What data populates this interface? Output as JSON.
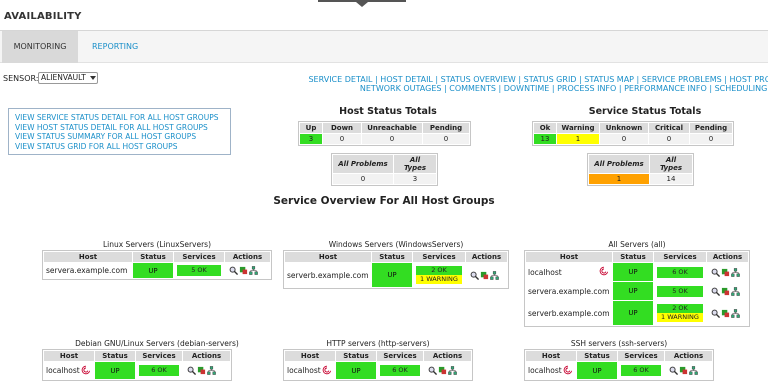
{
  "header": {
    "title": "AVAILABILITY"
  },
  "tabs": {
    "monitoring": "MONITORING",
    "reporting": "REPORTING"
  },
  "sensor": {
    "label": "SENSOR:",
    "value": "ALIENVAULT"
  },
  "nav": {
    "line1": [
      "SERVICE DETAIL",
      "HOST DETAIL",
      "STATUS OVERVIEW",
      "STATUS GRID",
      "STATUS MAP",
      "SERVICE PROBLEMS",
      "HOST PROBLEMS"
    ],
    "line2": [
      "NETWORK OUTAGES",
      "COMMENTS",
      "DOWNTIME",
      "PROCESS INFO",
      "PERFORMANCE INFO",
      "SCHEDULING QUEUE"
    ]
  },
  "links": [
    "VIEW SERVICE STATUS DETAIL FOR ALL HOST GROUPS",
    "VIEW HOST STATUS DETAIL FOR ALL HOST GROUPS",
    "VIEW STATUS SUMMARY FOR ALL HOST GROUPS",
    "VIEW STATUS GRID FOR ALL HOST GROUPS"
  ],
  "host_totals": {
    "title": "Host Status Totals",
    "headers": [
      "Up",
      "Down",
      "Unreachable",
      "Pending"
    ],
    "values": [
      "3",
      "0",
      "0",
      "0"
    ],
    "problem_headers": [
      "All Problems",
      "All Types"
    ],
    "problem_values": [
      "0",
      "3"
    ]
  },
  "service_totals": {
    "title": "Service Status Totals",
    "headers": [
      "Ok",
      "Warning",
      "Unknown",
      "Critical",
      "Pending"
    ],
    "values": [
      "13",
      "1",
      "0",
      "0",
      "0"
    ],
    "problem_headers": [
      "All Problems",
      "All Types"
    ],
    "problem_values": [
      "1",
      "14"
    ]
  },
  "overview_title": "Service Overview For All Host Groups",
  "columns": {
    "host": "Host",
    "status": "Status",
    "services": "Services",
    "actions": "Actions"
  },
  "groups": [
    {
      "title": "Linux Servers (LinuxServers)",
      "rows": [
        {
          "host": "servera.example.com",
          "status": "UP",
          "ok": "5 OK",
          "warn": ""
        }
      ]
    },
    {
      "title": "Windows Servers (WindowsServers)",
      "rows": [
        {
          "host": "serverb.example.com",
          "status": "UP",
          "ok": "2 OK",
          "warn": "1 WARNING"
        }
      ]
    },
    {
      "title": "All Servers (all)",
      "rows": [
        {
          "host": "localhost",
          "status": "UP",
          "ok": "6 OK",
          "warn": ""
        },
        {
          "host": "servera.example.com",
          "status": "UP",
          "ok": "5 OK",
          "warn": ""
        },
        {
          "host": "serverb.example.com",
          "status": "UP",
          "ok": "2 OK",
          "warn": "1 WARNING"
        }
      ]
    },
    {
      "title": "Debian GNU/Linux Servers (debian-servers)",
      "rows": [
        {
          "host": "localhost",
          "status": "UP",
          "ok": "6 OK",
          "warn": ""
        }
      ]
    },
    {
      "title": "HTTP servers (http-servers)",
      "rows": [
        {
          "host": "localhost",
          "status": "UP",
          "ok": "6 OK",
          "warn": ""
        }
      ]
    },
    {
      "title": "SSH servers (ssh-servers)",
      "rows": [
        {
          "host": "localhost",
          "status": "UP",
          "ok": "6 OK",
          "warn": ""
        }
      ]
    }
  ],
  "colors": {
    "link": "#1a8fc9",
    "ok": "#33dd22",
    "warning": "#ffff00",
    "problem": "#ffa100"
  }
}
